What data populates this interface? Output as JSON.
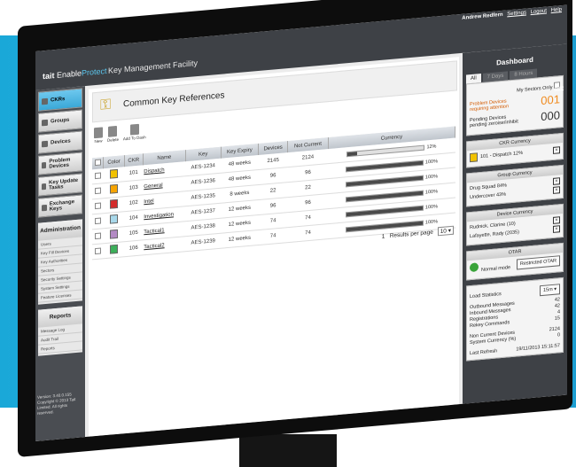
{
  "header": {
    "brand_a": "tait",
    "brand_b": "Enable",
    "brand_c": "Protect",
    "app_title": "Key Management Facility",
    "user": "Andrew Redfern",
    "settings_link": "Settings",
    "logout_link": "Logout",
    "help_link": "Help"
  },
  "nav": {
    "items": [
      {
        "label": "CKRs",
        "active": true
      },
      {
        "label": "Groups"
      },
      {
        "label": "Devices"
      },
      {
        "label": "Problem Devices"
      },
      {
        "label": "Key Update Tasks"
      },
      {
        "label": "Exchange Keys"
      }
    ],
    "admin": {
      "title": "Administration",
      "links": [
        "Users",
        "Key Fill Devices",
        "Key Authorities",
        "Sectors",
        "Security Settings",
        "System Settings",
        "Feature Licenses"
      ]
    },
    "reports": {
      "title": "Reports",
      "links": [
        "Message Log",
        "Audit Trail",
        "Reports"
      ]
    },
    "version": "Version: 3.40.0.155 Copyright © 2013 Tait Limited. All rights reserved."
  },
  "main": {
    "title": "Common Key References",
    "toolbar": {
      "new": "New",
      "delete": "Delete",
      "add_to_dash": "Add To Dash"
    },
    "columns": [
      "Color",
      "CKR",
      "Name",
      "Key",
      "Key Expiry",
      "Devices",
      "Not Current",
      "Currency"
    ],
    "rows": [
      {
        "color": "#f2c200",
        "ckr": "101",
        "name": "Dispatch",
        "key": "AES-1234",
        "expiry": "48 weeks",
        "devices": "2145",
        "not_current": "2124",
        "currency": 12,
        "currency_label": "12%"
      },
      {
        "color": "#f7a400",
        "ckr": "103",
        "name": "General",
        "key": "AES-1236",
        "expiry": "48 weeks",
        "devices": "96",
        "not_current": "96",
        "currency": 100,
        "currency_label": "100%"
      },
      {
        "color": "#d42b2b",
        "ckr": "102",
        "name": "Intel",
        "key": "AES-1235",
        "expiry": "8 weeks",
        "devices": "22",
        "not_current": "22",
        "currency": 100,
        "currency_label": "100%"
      },
      {
        "color": "#a8d8ea",
        "ckr": "104",
        "name": "Investigation",
        "key": "AES-1237",
        "expiry": "12 weeks",
        "devices": "96",
        "not_current": "96",
        "currency": 100,
        "currency_label": "100%"
      },
      {
        "color": "#b38ac4",
        "ckr": "105",
        "name": "Tactical1",
        "key": "AES-1238",
        "expiry": "12 weeks",
        "devices": "74",
        "not_current": "74",
        "currency": 100,
        "currency_label": "100%"
      },
      {
        "color": "#3cb05a",
        "ckr": "106",
        "name": "Tactical2",
        "key": "AES-1239",
        "expiry": "12 weeks",
        "devices": "74",
        "not_current": "74",
        "currency": 100,
        "currency_label": "100%"
      }
    ],
    "pager": {
      "page": "1",
      "label": "Results per page",
      "per_page": "10"
    }
  },
  "dashboard": {
    "title": "Dashboard",
    "tabs": [
      "All",
      "7 Days",
      "8 Hours"
    ],
    "my_sectors": "My Sectors Only",
    "problem_label": "Problem Devices requiring attention",
    "problem_count": "001",
    "pending_label": "Pending Devices pending zeroise/inhibit",
    "pending_count": "000",
    "ckr_currency": {
      "title": "CKR Currency",
      "item": "101 - Dispatch 12%"
    },
    "group_currency": {
      "title": "Group Currency",
      "items": [
        "Drug Squad 84%",
        "Undercover 43%"
      ]
    },
    "device_currency": {
      "title": "Device Currency",
      "items": [
        "Rudnick, Clarine (10)",
        "Lafayette, Rady (2035)"
      ]
    },
    "otar": {
      "title": "OTAR",
      "mode": "Normal mode",
      "button": "Restricted OTAR"
    },
    "load_stats": {
      "label": "Load Statistics",
      "interval": "15m",
      "rows": [
        {
          "label": "Outbound Messages",
          "value": "42"
        },
        {
          "label": "Inbound Messages",
          "value": "42"
        },
        {
          "label": "Registrations",
          "value": "4"
        },
        {
          "label": "Rekey Commands",
          "value": "15"
        }
      ]
    },
    "non_current_label": "Non Current Devices",
    "non_current_value": "2124",
    "system_currency_label": "System Currency (%)",
    "system_currency_value": "0",
    "last_refresh_label": "Last Refresh",
    "last_refresh_value": "19/11/2013 15:11:57"
  }
}
